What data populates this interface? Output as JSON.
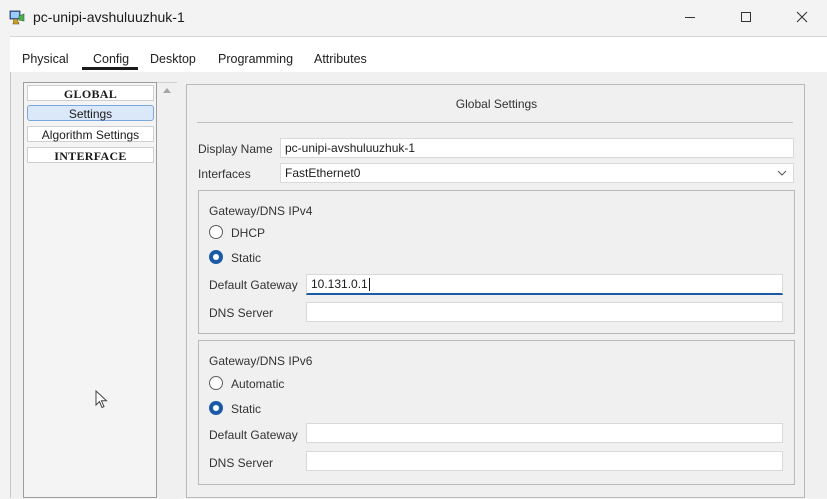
{
  "window": {
    "title": "pc-unipi-avshuluuzhuk-1",
    "controls": {
      "minimize": "—",
      "maximize": "☐",
      "close": "✕"
    }
  },
  "tabs": [
    {
      "label": "Physical"
    },
    {
      "label": "Config"
    },
    {
      "label": "Desktop"
    },
    {
      "label": "Programming"
    },
    {
      "label": "Attributes"
    }
  ],
  "active_tab": "Config",
  "sidebar": {
    "items": [
      {
        "label": "GLOBAL"
      },
      {
        "label": "Settings"
      },
      {
        "label": "Algorithm Settings"
      },
      {
        "label": "INTERFACE"
      }
    ],
    "selected": "Settings"
  },
  "panel": {
    "title": "Global Settings",
    "display_name_label": "Display Name",
    "display_name_value": "pc-unipi-avshuluuzhuk-1",
    "interfaces_label": "Interfaces",
    "interfaces_value": "FastEthernet0",
    "ipv4": {
      "title": "Gateway/DNS IPv4",
      "dhcp_label": "DHCP",
      "static_label": "Static",
      "selected": "Static",
      "gateway_label": "Default Gateway",
      "gateway_value": "10.131.0.1",
      "dns_label": "DNS Server",
      "dns_value": ""
    },
    "ipv6": {
      "title": "Gateway/DNS IPv6",
      "automatic_label": "Automatic",
      "static_label": "Static",
      "selected": "Static",
      "gateway_label": "Default Gateway",
      "gateway_value": "",
      "dns_label": "DNS Server",
      "dns_value": ""
    }
  },
  "colors": {
    "accent": "#1a5aa6",
    "selected_bg": "#dbe8f9"
  }
}
